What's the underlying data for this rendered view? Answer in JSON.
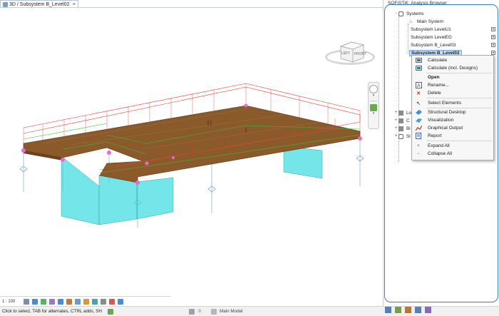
{
  "view_tab": {
    "title": "3D / Subsystem B_Level02",
    "close": "×"
  },
  "viewport": {
    "scale": "1 : 100"
  },
  "viewcube": {
    "left_face": "LEFT",
    "front_face": "FRONT"
  },
  "status": {
    "hint": "Click to select, TAB for alternates, CTRL adds, SH",
    "count_a": ":0",
    "count_b": ":0",
    "model": "Main Model"
  },
  "browser": {
    "title": "SOFiSTiK: Analysis Browser",
    "tree": [
      {
        "label": "Systems",
        "toggle": "−",
        "level": 1
      },
      {
        "label": "Main System",
        "level": 2
      },
      {
        "label": "Subsystem LevelU1",
        "level": 2,
        "pinned": true
      },
      {
        "label": "Subsystem LevelEG",
        "level": 2,
        "pinned": true
      },
      {
        "label": "Subsystem B_Level03",
        "level": 2,
        "pinned": true
      },
      {
        "label": "Subsystem B_Level02",
        "level": 2,
        "pinned": true,
        "selected": true
      }
    ],
    "collapsed_nodes": [
      {
        "label": "Lo",
        "toggle": "+"
      },
      {
        "label": "C",
        "toggle": "+"
      },
      {
        "label": "Bi",
        "toggle": "+"
      },
      {
        "label": "Sl",
        "toggle": "+"
      }
    ]
  },
  "context_menu": {
    "items": [
      {
        "label": "Calculate",
        "icon": "calculate-icon"
      },
      {
        "label": "Calculate (incl. Designs)",
        "icon": "calculate-designs-icon"
      },
      {
        "label": "Open",
        "icon": "",
        "bold": true
      },
      {
        "label": "Rename...",
        "icon": "rename-icon"
      },
      {
        "label": "Delete",
        "icon": "delete-icon"
      },
      {
        "label": "Select Elements",
        "icon": "select-elements-icon"
      },
      {
        "label": "Structural Desktop",
        "icon": "structural-desktop-icon"
      },
      {
        "label": "Visualization",
        "icon": "visualization-icon"
      },
      {
        "label": "Graphical Output",
        "icon": "graphical-output-icon"
      },
      {
        "label": "Report",
        "icon": "report-icon"
      },
      {
        "label": "Expand All",
        "icon": "expand-all-icon"
      },
      {
        "label": "Collapse All",
        "icon": "collapse-all-icon"
      }
    ]
  },
  "colors": {
    "accent": "#2f7fd0",
    "slab": "#8b5a2b",
    "wall": "#2fd0d6",
    "rail_red": "#e03a2a",
    "rail_green": "#38c038"
  }
}
